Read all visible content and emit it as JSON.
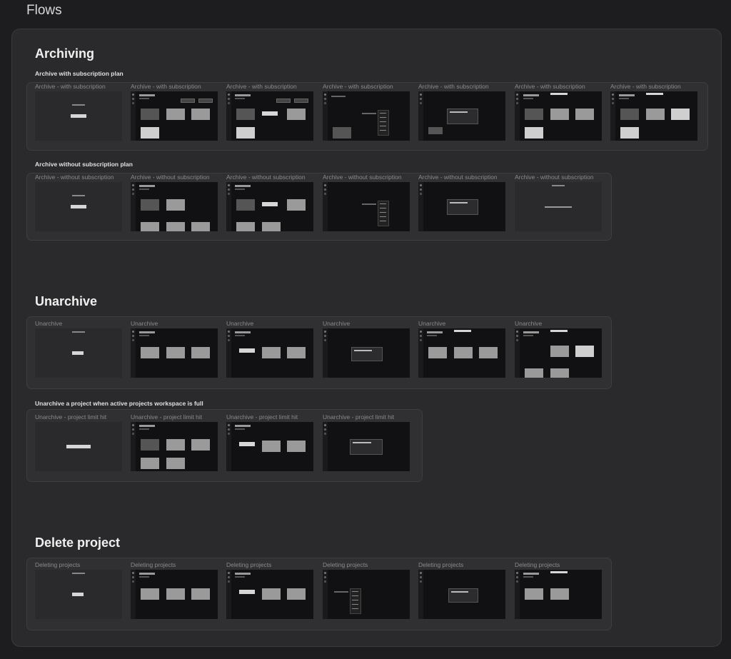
{
  "page": {
    "title": "Flows"
  },
  "sections": {
    "archiving": {
      "title": "Archiving",
      "flows": [
        {
          "label": "Archive with subscription plan",
          "frames": [
            "Archive - with subscription",
            "Archive - with subscription",
            "Archive - with subscription",
            "Archive - with subscription",
            "Archive - with subscription",
            "Archive - with subscription",
            "Archive - with subscription"
          ]
        },
        {
          "label": "Archive without subscription plan",
          "frames": [
            "Archive - without subscription",
            "Archive - without subscription",
            "Archive - without subscription",
            "Archive - without subscription",
            "Archive - without subscription",
            "Archive - without subscription"
          ]
        }
      ]
    },
    "unarchive": {
      "title": "Unarchive",
      "flows": [
        {
          "label": "",
          "frames": [
            "Unarchive",
            "Unarchive",
            "Unarchive",
            "Unarchive",
            "Unarchive",
            "Unarchive"
          ]
        },
        {
          "label": "Unarchive a project when active projects workspace is full",
          "frames": [
            "Unarchive - project limit hit",
            "Unarchive - project limit hit",
            "Unarchive - project limit hit",
            "Unarchive - project limit hit"
          ]
        }
      ]
    },
    "delete": {
      "title": "Delete project",
      "flows": [
        {
          "label": "",
          "frames": [
            "Deleting projects",
            "Deleting projects",
            "Deleting projects",
            "Deleting projects",
            "Deleting projects",
            "Deleting projects"
          ]
        }
      ]
    }
  }
}
